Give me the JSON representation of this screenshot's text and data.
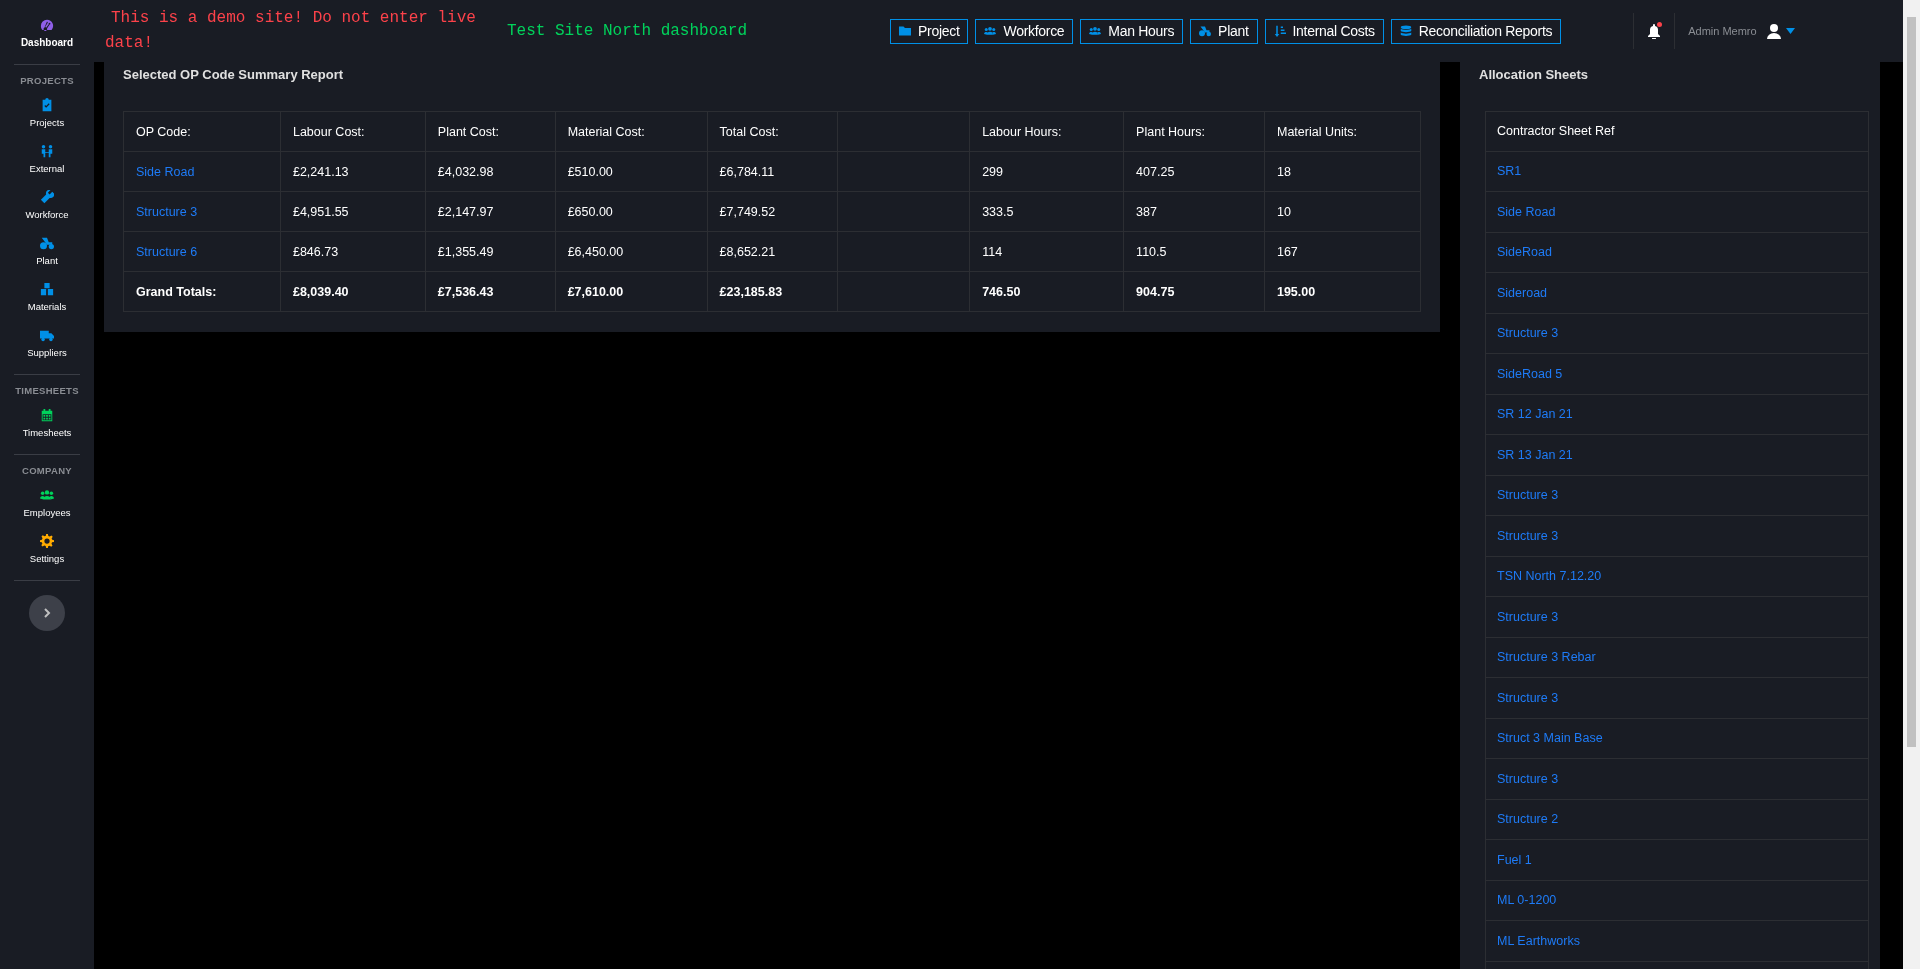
{
  "sidebar": {
    "sections": [
      {
        "items": [
          {
            "label": "Dashboard",
            "selected": true,
            "color": "#8f5fe8"
          }
        ]
      },
      {
        "heading": "PROJECTS",
        "items": [
          {
            "label": "Projects",
            "selected": false,
            "color": "#0090e7"
          },
          {
            "label": "External",
            "selected": false,
            "color": "#0090e7"
          },
          {
            "label": "Workforce",
            "selected": false,
            "color": "#0090e7"
          },
          {
            "label": "Plant",
            "selected": false,
            "color": "#0090e7"
          },
          {
            "label": "Materials",
            "selected": false,
            "color": "#0090e7"
          },
          {
            "label": "Suppliers",
            "selected": false,
            "color": "#0090e7"
          }
        ]
      },
      {
        "heading": "TIMESHEETS",
        "items": [
          {
            "label": "Timesheets",
            "selected": false,
            "color": "#00d25b"
          }
        ]
      },
      {
        "heading": "COMPANY",
        "items": [
          {
            "label": "Employees",
            "selected": false,
            "color": "#00d25b"
          },
          {
            "label": "Settings",
            "selected": false,
            "color": "#ffab00"
          }
        ]
      }
    ]
  },
  "top_bar": {
    "warning": "This is a demo site! Do not enter live data!",
    "site_title": "Test Site North dashboard",
    "nav_buttons": [
      "Project",
      "Workforce",
      "Man Hours",
      "Plant",
      "Internal Costs",
      "Reconciliation Reports"
    ],
    "notifications": {
      "unread": true
    },
    "user_name": "Admin Memro"
  },
  "summary": {
    "title": "Selected OP Code Summary Report",
    "columns": [
      "OP Code:",
      "Labour Cost:",
      "Plant Cost:",
      "Material Cost:",
      "Total Cost:",
      "Labour Hours:",
      "Plant Hours:",
      "Material Units:"
    ],
    "rows": [
      {
        "kind": "link",
        "cells": [
          "Side Road",
          "£2,241.13",
          "£4,032.98",
          "£510.00",
          "£6,784.11",
          "299",
          "407.25",
          "18"
        ]
      },
      {
        "kind": "link",
        "cells": [
          "Structure 3",
          "£4,951.55",
          "£2,147.97",
          "£650.00",
          "£7,749.52",
          "333.5",
          "387",
          "10"
        ]
      },
      {
        "kind": "link",
        "cells": [
          "Structure 6",
          "£846.73",
          "£1,355.49",
          "£6,450.00",
          "£8,652.21",
          "114",
          "110.5",
          "167"
        ]
      },
      {
        "kind": "total",
        "cells": [
          "Grand Totals:",
          "£8,039.40",
          "£7,536.43",
          "£7,610.00",
          "£23,185.83",
          "746.50",
          "904.75",
          "195.00"
        ]
      }
    ]
  },
  "allocation_sheets": {
    "title": "Allocation Sheets",
    "header": "Contractor Sheet Ref",
    "items": [
      "SR1",
      "Side Road",
      "SideRoad",
      "Sideroad",
      "Structure 3",
      "SideRoad 5",
      "SR 12 Jan 21",
      "SR 13 Jan 21",
      "Structure 3",
      "Structure 3",
      "TSN North 7.12.20",
      "Structure 3",
      "Structure 3 Rebar",
      "Structure 3",
      "Struct 3 Main Base",
      "Structure 3",
      "Structure 2",
      "Fuel 1",
      "ML 0-1200",
      "ML Earthworks"
    ]
  }
}
